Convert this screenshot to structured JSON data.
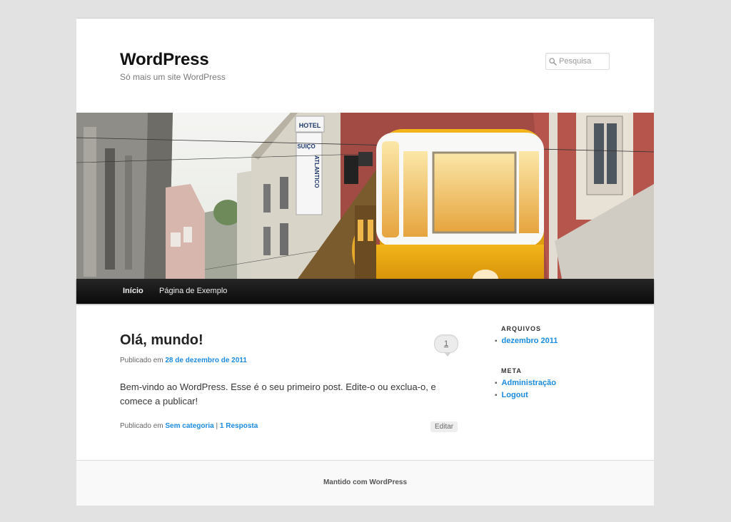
{
  "site": {
    "title": "WordPress",
    "description": "Só mais um site WordPress"
  },
  "search": {
    "placeholder": "Pesquisa",
    "icon": "search-icon"
  },
  "header_image": {
    "subject": "yellow Lisbon tram on a street with Hotel Suiço Atlântico sign"
  },
  "header_sign": {
    "line1": "HOTEL",
    "line2": "SUIÇO",
    "line3": "ATLANTICO"
  },
  "menu": {
    "items": [
      {
        "label": "Início"
      },
      {
        "label": "Página de Exemplo"
      }
    ]
  },
  "post": {
    "title": "Olá, mundo!",
    "comment_count": "1",
    "published_prefix": "Publicado em",
    "date": "28 de dezembro de 2011",
    "content": "Bem-vindo ao WordPress. Esse é o seu primeiro post. Edite-o ou exclua-o, e comece a publicar!",
    "category_prefix": "Publicado em",
    "category": "Sem categoria",
    "separator": "|",
    "replies": "1 Resposta",
    "edit_label": "Editar"
  },
  "sidebar": {
    "archives": {
      "title": "ARQUIVOS",
      "items": [
        "dezembro 2011"
      ]
    },
    "meta": {
      "title": "META",
      "items": [
        "Administração",
        "Logout"
      ]
    }
  },
  "footer": {
    "text": "Mantido com WordPress"
  },
  "colors": {
    "link": "#1b8be0",
    "menu_bg": "#1a1a1a",
    "page_bg": "#e2e2e2"
  }
}
